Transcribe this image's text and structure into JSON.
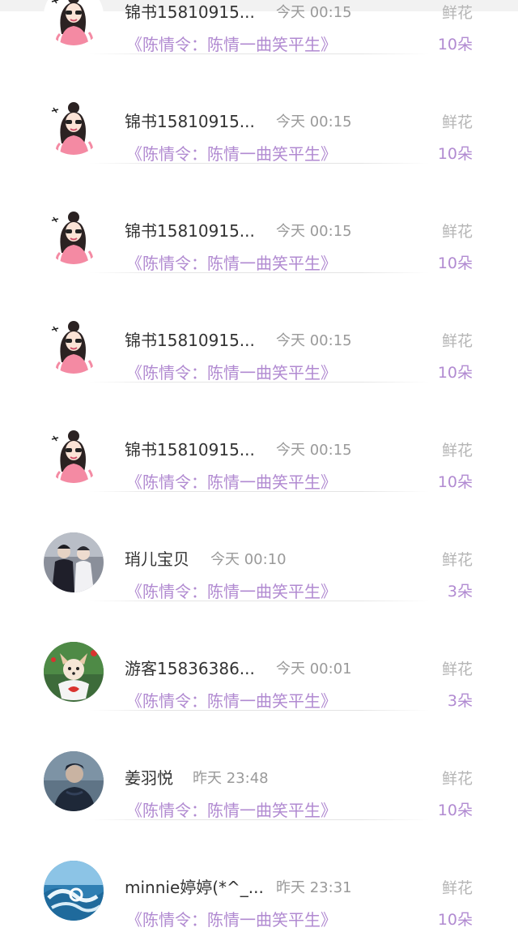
{
  "items": [
    {
      "avatar": "cartoon-girl-avatar",
      "name": "锦书15810915...",
      "time": "今天 00:15",
      "book": "《陈情令：陈情一曲笑平生》",
      "gift": "鲜花",
      "amount": "10朵"
    },
    {
      "avatar": "cartoon-girl-avatar",
      "name": "锦书15810915...",
      "time": "今天 00:15",
      "book": "《陈情令：陈情一曲笑平生》",
      "gift": "鲜花",
      "amount": "10朵"
    },
    {
      "avatar": "cartoon-girl-avatar",
      "name": "锦书15810915...",
      "time": "今天 00:15",
      "book": "《陈情令：陈情一曲笑平生》",
      "gift": "鲜花",
      "amount": "10朵"
    },
    {
      "avatar": "cartoon-girl-avatar",
      "name": "锦书15810915...",
      "time": "今天 00:15",
      "book": "《陈情令：陈情一曲笑平生》",
      "gift": "鲜花",
      "amount": "10朵"
    },
    {
      "avatar": "cartoon-girl-avatar",
      "name": "锦书15810915...",
      "time": "今天 00:15",
      "book": "《陈情令：陈情一曲笑平生》",
      "gift": "鲜花",
      "amount": "10朵"
    },
    {
      "avatar": "two-men-photo-avatar",
      "name": "琑儿宝贝",
      "time": "今天 00:10",
      "book": "《陈情令：陈情一曲笑平生》",
      "gift": "鲜花",
      "amount": "3朵"
    },
    {
      "avatar": "puppy-photo-avatar",
      "name": "游客15836386...",
      "time": "今天 00:01",
      "book": "《陈情令：陈情一曲笑平生》",
      "gift": "鲜花",
      "amount": "3朵"
    },
    {
      "avatar": "man-portrait-avatar",
      "name": "姜羽悦",
      "time": "昨天 23:48",
      "book": "《陈情令：陈情一曲笑平生》",
      "gift": "鲜花",
      "amount": "10朵"
    },
    {
      "avatar": "ocean-wave-avatar",
      "name": "minnie婷婷(*^_...",
      "time": "昨天 23:31",
      "book": "《陈情令：陈情一曲笑平生》",
      "gift": "鲜花",
      "amount": "10朵"
    }
  ],
  "colors": {
    "accent": "#b18ad1",
    "name": "#333333",
    "meta": "#9a9a9a",
    "gift": "#b5b5b5"
  }
}
